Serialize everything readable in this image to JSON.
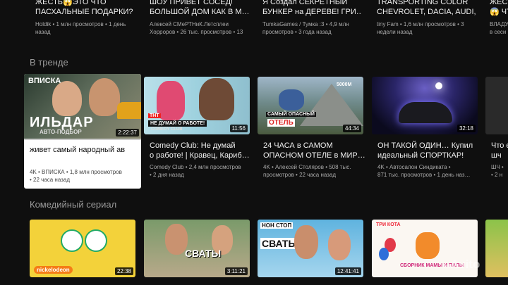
{
  "top_row": [
    {
      "title_l1": "ЖЕСТЬ😱ЭТО ЧТО",
      "title_l2": "ПАСХАЛЬНЫЕ ПОДАРКИ?",
      "meta_l1": "Holdik • 1 млн просмотров • 1 день",
      "meta_l2": "назад"
    },
    {
      "title_l1": "ШОУ ПРИВЕТ СОСЕД!",
      "title_l2": "БОЛЬШОЙ ДОМ КАК В М…",
      "meta_l1": "Алексей СМеРТНиК.Летсплеи",
      "meta_l2": "Хорроров • 26 тыс. просмотров • 13"
    },
    {
      "title_l1": "Я Создал СЕКРЕТНЫЙ",
      "title_l2": "БУНКЕР на ДЕРЕВЕ! ГРИ…",
      "meta_l1": "TumkaGames / Тумка :3 • 4,9 млн",
      "meta_l2": "просмотров • 3 года назад"
    },
    {
      "title_l1": "TRANSPORTING COLOR",
      "title_l2": "CHEVROLET, DACIA, AUDI, …",
      "meta_l1": "tiny Fam • 1,6 млн просмотров • 3",
      "meta_l2": "недели назад"
    },
    {
      "title_l1": "ЖЕСТ",
      "title_l2": "😱 ЧТО",
      "meta_l1": "ВЛАДУ",
      "meta_l2": "в сеси"
    }
  ],
  "trending": {
    "heading": "В тренде",
    "cards": [
      {
        "duration": "2:22:37",
        "title_l1": "живет самый народный ав",
        "title_l2": "",
        "meta_l1": "4K • ВПИСКА • 1,8 млн просмотров",
        "meta_l2": "• 22 часа назад",
        "overlay_top": "ВПИСКА",
        "overlay_big": "ИЛЬДАР",
        "overlay_small": "АВТО-ПОДБОР"
      },
      {
        "duration": "11:56",
        "title_l1": "Comedy Club: Не думай",
        "title_l2": "о работе! | Кравец, Кариб…",
        "meta_l1": "Comedy Club • 2,4 млн просмотров",
        "meta_l2": "• 2 дня назад",
        "overlay_top": "ТНТ",
        "overlay_big": "НЕ ДУМАЙ О РАБОТЕ!",
        "overlay_small": "COMEDY CLUB"
      },
      {
        "duration": "44:34",
        "title_l1": "24 ЧАСА в САМОМ",
        "title_l2": "ОПАСНОМ ОТЕЛЕ в МИР…",
        "meta_l1": "4K • Алексей Столяров • 508 тыс.",
        "meta_l2": "просмотров • 22 часа назад",
        "overlay_top": "5000М",
        "overlay_big": "ОТЕЛЬ",
        "overlay_small": "САМЫЙ ОПАСНЫЙ"
      },
      {
        "duration": "32:18",
        "title_l1": "ОН ТАКОЙ ОДИН… Купил",
        "title_l2": "идеальный СПОРТКАР!",
        "meta_l1": "4K • Автосалон Синдиката •",
        "meta_l2": "871 тыс. просмотров • 1 день наз…",
        "overlay_top": "",
        "overlay_big": "",
        "overlay_small": ""
      },
      {
        "duration": "",
        "title_l1": "Что е",
        "title_l2": "шч",
        "meta_l1": "ШЧ •",
        "meta_l2": "• 2 н",
        "overlay_top": "",
        "overlay_big": "",
        "overlay_small": ""
      }
    ]
  },
  "comedy": {
    "heading": "Комедийный сериал",
    "cards": [
      {
        "duration": "22:38",
        "title": "",
        "overlay_big": "nickelodeon"
      },
      {
        "duration": "3:11:21",
        "title": "",
        "overlay_big": "СВАТЫ"
      },
      {
        "duration": "12:41:41",
        "title": "",
        "overlay_big": "СВАТЫ",
        "overlay_small": "НОН СТОП"
      },
      {
        "duration": "",
        "title": "",
        "overlay_big": "СБОРНИК МАМЫ И ПАПЫ",
        "overlay_small": "ТРИ КОТА"
      },
      {
        "duration": "",
        "title": "",
        "overlay_big": ""
      }
    ]
  },
  "watermark": "Avito",
  "colors": {
    "background": "#0f0f0f",
    "focus_card": "#ffffff",
    "meta": "#aaaaaa"
  }
}
